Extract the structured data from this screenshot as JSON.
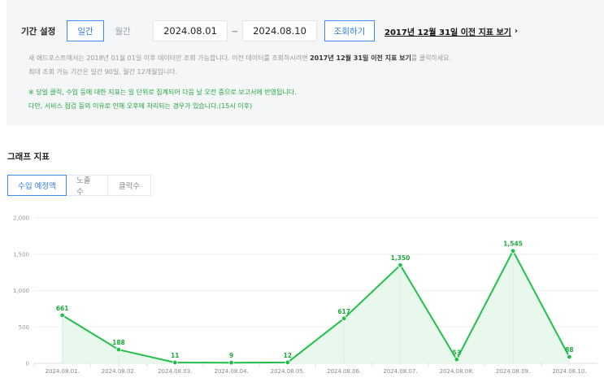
{
  "filter": {
    "period_label": "기간 설정",
    "modes": [
      {
        "label": "일간",
        "active": true
      },
      {
        "label": "월간",
        "active": false
      }
    ],
    "start_date": "2024.08.01",
    "separator": "~",
    "end_date": "2024.08.10",
    "query_button": "조회하기",
    "legacy_link": "2017년 12월 31일 이전 지표 보기",
    "legacy_arrow": "›"
  },
  "notes": {
    "line1_prefix": "새 애드포스트에서는 2018년 01월 01일 이후 데이터만 조회 가능합니다. 이전 데이터를 조회하시려면 ",
    "line1_bold": "2017년 12월 31일 이전 지표 보기",
    "line1_suffix": "를 클릭하세요.",
    "line2": "최대 조회 가능 기간은 일간 90일, 월간 12개월입니다.",
    "line3": "※ 당일 클릭, 수입 등에 대한 지표는 일 단위로 집계되어 다음 날 오전 중으로 보고서에 반영됩니다.",
    "line4": "다만, 서비스 점검 등의 이유로 인해 오후에 처리되는 경우가 있습니다.(15시 이후)"
  },
  "graph": {
    "title": "그래프 지표",
    "tabs": [
      {
        "label": "수입 예정액",
        "active": true
      },
      {
        "label": "노출수",
        "active": false
      },
      {
        "label": "클릭수",
        "active": false
      }
    ]
  },
  "colors": {
    "accent_blue": "#3b8ef0",
    "line_green": "#22c04a",
    "area_green": "#e9f8ec",
    "note_green": "#22a63a",
    "panel_bg": "#f4f6f8"
  },
  "chart_data": {
    "type": "area",
    "categories": [
      "2024.08.01.",
      "2024.08.02.",
      "2024.08.03.",
      "2024.08.04.",
      "2024.08.05.",
      "2024.08.06.",
      "2024.08.07.",
      "2024.08.08.",
      "2024.08.09.",
      "2024.08.10."
    ],
    "values": [
      661,
      188,
      11,
      9,
      12,
      617,
      1350,
      53,
      1545,
      88
    ],
    "value_labels": [
      "661",
      "188",
      "11",
      "9",
      "12",
      "617",
      "1,350",
      "53",
      "1,545",
      "88"
    ],
    "yticks": [
      0,
      500,
      1000,
      1500,
      2000
    ],
    "ytick_labels": [
      "0",
      "500",
      "1,000",
      "1,500",
      "2,000"
    ],
    "ylim": [
      0,
      2000
    ],
    "grid": true,
    "title": "",
    "xlabel": "",
    "ylabel": ""
  }
}
